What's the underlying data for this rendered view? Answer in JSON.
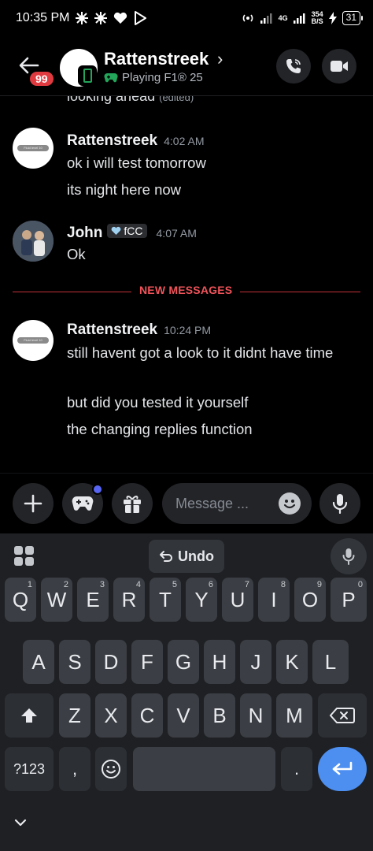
{
  "status_bar": {
    "time": "10:35 PM",
    "network_label": "4G",
    "speed_value": "354",
    "speed_unit": "B/S",
    "battery": "31"
  },
  "header": {
    "unread_count": "99",
    "name": "Rattenstreek",
    "activity": "Playing F1® 25"
  },
  "messages": {
    "previous_line": "looking ahead",
    "previous_edited": "(edited)",
    "groups": [
      {
        "author": "Rattenstreek",
        "time": "4:02 AM",
        "avatar_caption": "Fluid level 10",
        "lines": [
          "ok i will test tomorrow",
          "its night here now"
        ]
      },
      {
        "author": "John",
        "tag": "fCC",
        "time": "4:07 AM",
        "lines": [
          "Ok"
        ]
      },
      {
        "author": "Rattenstreek",
        "time": "10:24 PM",
        "avatar_caption": "Fluid level 10",
        "lines": [
          "still havent got a look to it didnt have time",
          "but did you tested it yourself",
          "the changing replies function"
        ]
      }
    ],
    "new_messages_label": "NEW MESSAGES"
  },
  "composer": {
    "placeholder": "Message ..."
  },
  "keyboard": {
    "undo_label": "Undo",
    "row1": [
      "Q",
      "W",
      "E",
      "R",
      "T",
      "Y",
      "U",
      "I",
      "O",
      "P"
    ],
    "row1_hints": [
      "1",
      "2",
      "3",
      "4",
      "5",
      "6",
      "7",
      "8",
      "9",
      "0"
    ],
    "row2": [
      "A",
      "S",
      "D",
      "F",
      "G",
      "H",
      "J",
      "K",
      "L"
    ],
    "row3": [
      "Z",
      "X",
      "C",
      "V",
      "B",
      "N",
      "M"
    ],
    "symbols_label": "?123",
    "comma": ",",
    "period": "."
  },
  "colors": {
    "accent_blue": "#5865f2",
    "new_messages_red": "#f0535a",
    "online_green": "#23a55a",
    "enter_key": "#4d8ff0"
  }
}
